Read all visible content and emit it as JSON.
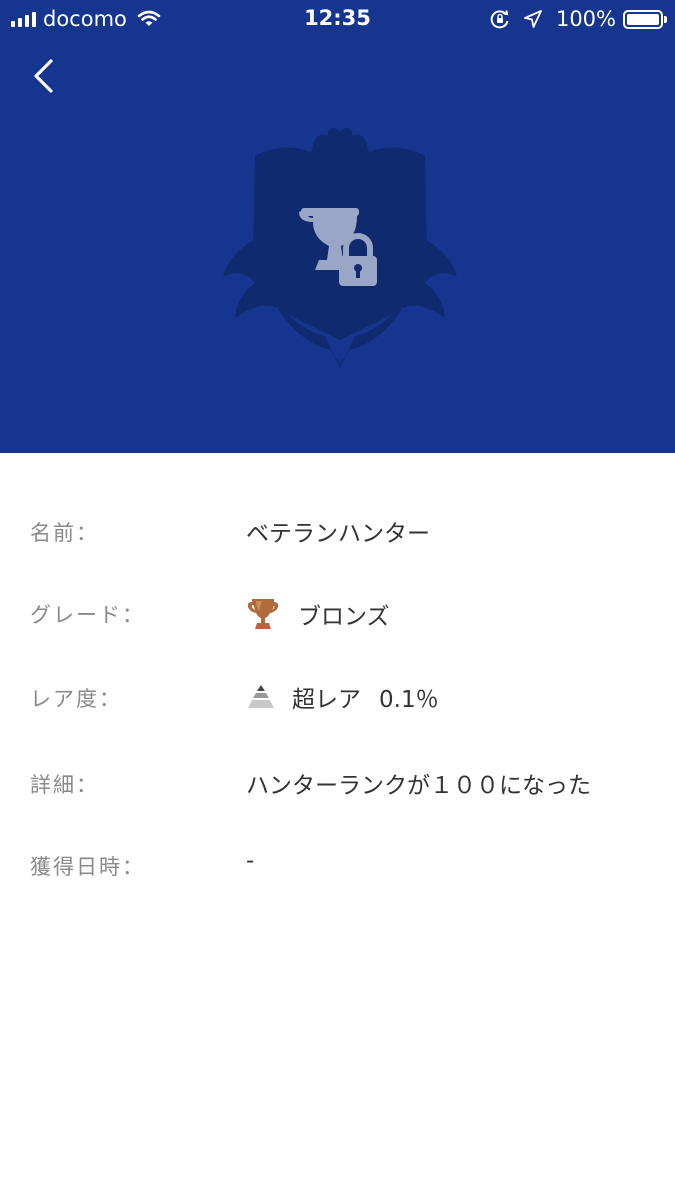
{
  "status_bar": {
    "carrier": "docomo",
    "time": "12:35",
    "battery": "100%",
    "icons": [
      "signal-icon",
      "wifi-icon",
      "rotation-lock-icon",
      "location-icon",
      "battery-icon"
    ]
  },
  "header": {
    "back_icon": "chevron-left-icon",
    "image_icon": "locked-trophy-crest-icon"
  },
  "details": {
    "name": {
      "label": "名前：",
      "value": "ベテランハンター"
    },
    "grade": {
      "label": "グレード：",
      "value": "ブロンズ",
      "icon": "bronze-trophy-icon"
    },
    "rarity": {
      "label": "レア度：",
      "value": "超レア",
      "percent": "0.1％",
      "icon": "rarity-pyramid-icon"
    },
    "detail": {
      "label": "詳細：",
      "value": "ハンターランクが１００になった"
    },
    "earned": {
      "label": "獲得日時：",
      "value": "-"
    }
  },
  "colors": {
    "hero_background": "#15358f",
    "crest": "#0f2a6e",
    "locked_trophy": "#9aa6c6",
    "bronze": "#b06a3b",
    "label_text": "#8a8a8a",
    "value_text": "#333333"
  }
}
